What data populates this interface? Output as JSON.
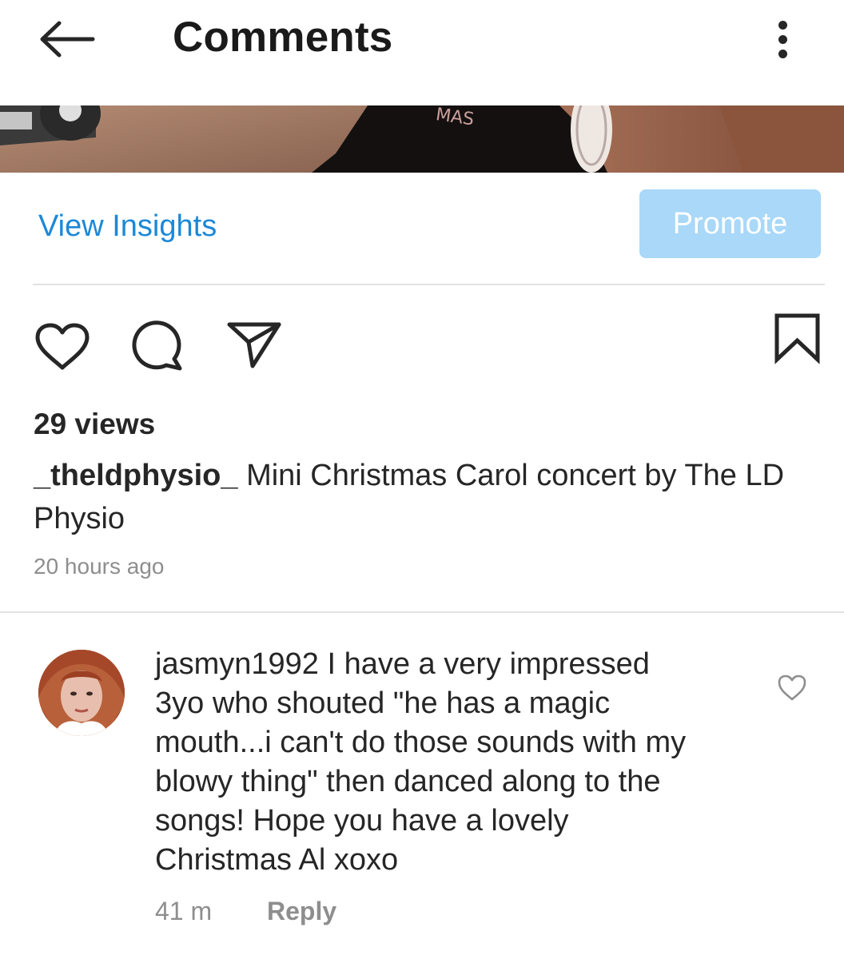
{
  "header": {
    "title": "Comments",
    "back_icon": "arrow-left-icon",
    "menu_icon": "more-vertical-icon"
  },
  "post_actions": {
    "insights_label": "View Insights",
    "promote_label": "Promote",
    "icons": [
      "heart-icon",
      "comment-icon",
      "share-icon",
      "bookmark-icon"
    ],
    "colors": {
      "link": "#1b88d8",
      "promote_bg": "#a9d8f8"
    }
  },
  "post": {
    "views": "29 views",
    "username": "_theldphysio_",
    "caption": "Mini Christmas Carol concert by The LD Physio",
    "time": "20 hours ago"
  },
  "comments": [
    {
      "username": "jasmyn1992",
      "text": "I have a very impressed 3yo who shouted \"he has a magic mouth...i can't do those sounds with my blowy thing\" then danced along to the songs! Hope you have a lovely Christmas Al xoxo",
      "time": "41 m",
      "reply_label": "Reply"
    }
  ]
}
